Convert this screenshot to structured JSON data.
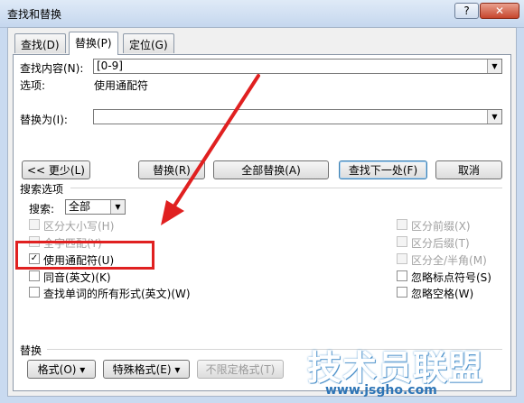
{
  "window": {
    "title": "查找和替换",
    "help_glyph": "?",
    "close_glyph": "✕"
  },
  "tabs": [
    {
      "label": "查找(D)",
      "active": false
    },
    {
      "label": "替换(P)",
      "active": true
    },
    {
      "label": "定位(G)",
      "active": false
    }
  ],
  "find": {
    "label": "查找内容(N):",
    "value": "[0-9]",
    "options_label": "选项:",
    "options_value": "使用通配符"
  },
  "replace": {
    "label": "替换为(I):",
    "value": ""
  },
  "buttons": {
    "less": "<< 更少(L)",
    "replace": "替换(R)",
    "replace_all": "全部替换(A)",
    "find_next": "查找下一处(F)",
    "cancel": "取消"
  },
  "search_options": {
    "title": "搜索选项",
    "search_label": "搜索:",
    "search_value": "全部",
    "left": [
      {
        "label": "区分大小写(H)",
        "checked": false,
        "enabled": false
      },
      {
        "label": "全字匹配(Y)",
        "checked": false,
        "enabled": false
      },
      {
        "label": "使用通配符(U)",
        "checked": true,
        "enabled": true
      },
      {
        "label": "同音(英文)(K)",
        "checked": false,
        "enabled": true
      },
      {
        "label": "查找单词的所有形式(英文)(W)",
        "checked": false,
        "enabled": true
      }
    ],
    "right": [
      {
        "label": "区分前缀(X)",
        "checked": false,
        "enabled": false
      },
      {
        "label": "区分后缀(T)",
        "checked": false,
        "enabled": false
      },
      {
        "label": "区分全/半角(M)",
        "checked": false,
        "enabled": false
      },
      {
        "label": "忽略标点符号(S)",
        "checked": false,
        "enabled": true
      },
      {
        "label": "忽略空格(W)",
        "checked": false,
        "enabled": true
      }
    ]
  },
  "replace_section": {
    "title": "替换",
    "format_button": "格式(O) ▾",
    "special_button": "特殊格式(E) ▾",
    "no_format_button": "不限定格式(T)"
  },
  "watermark": {
    "text": "技术员联盟",
    "url": "www.jsgho.com"
  },
  "colors": {
    "highlight": "#e02020",
    "arrow": "#e02020"
  }
}
